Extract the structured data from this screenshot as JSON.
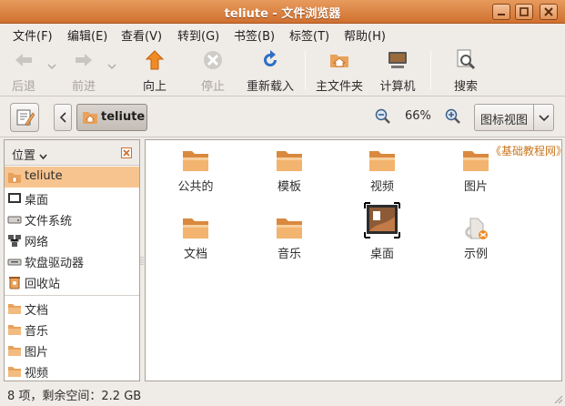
{
  "window": {
    "title": "teliute - 文件浏览器"
  },
  "menubar": {
    "items": [
      "文件(F)",
      "编辑(E)",
      "查看(V)",
      "转到(G)",
      "书签(B)",
      "标签(T)",
      "帮助(H)"
    ]
  },
  "toolbar": {
    "back": "后退",
    "forward": "前进",
    "up": "向上",
    "stop": "停止",
    "reload": "重新载入",
    "home": "主文件夹",
    "computer": "计算机",
    "search": "搜索"
  },
  "location": {
    "crumb": "teliute",
    "zoom": "66%",
    "view_mode": "图标视图"
  },
  "sidebar": {
    "header": "位置",
    "places": [
      "teliute",
      "桌面",
      "文件系统",
      "网络",
      "软盘驱动器",
      "回收站"
    ],
    "bookmarks": [
      "文档",
      "音乐",
      "图片",
      "视频"
    ]
  },
  "files": [
    "公共的",
    "模板",
    "视频",
    "图片",
    "文档",
    "音乐",
    "桌面",
    "示例"
  ],
  "watermark": "《基础教程网》",
  "status": "8 项，剩余空间：2.2 GB",
  "colors": {
    "accent": "#d0702f",
    "selection": "#f7c490",
    "folder": "#e8a25c"
  }
}
